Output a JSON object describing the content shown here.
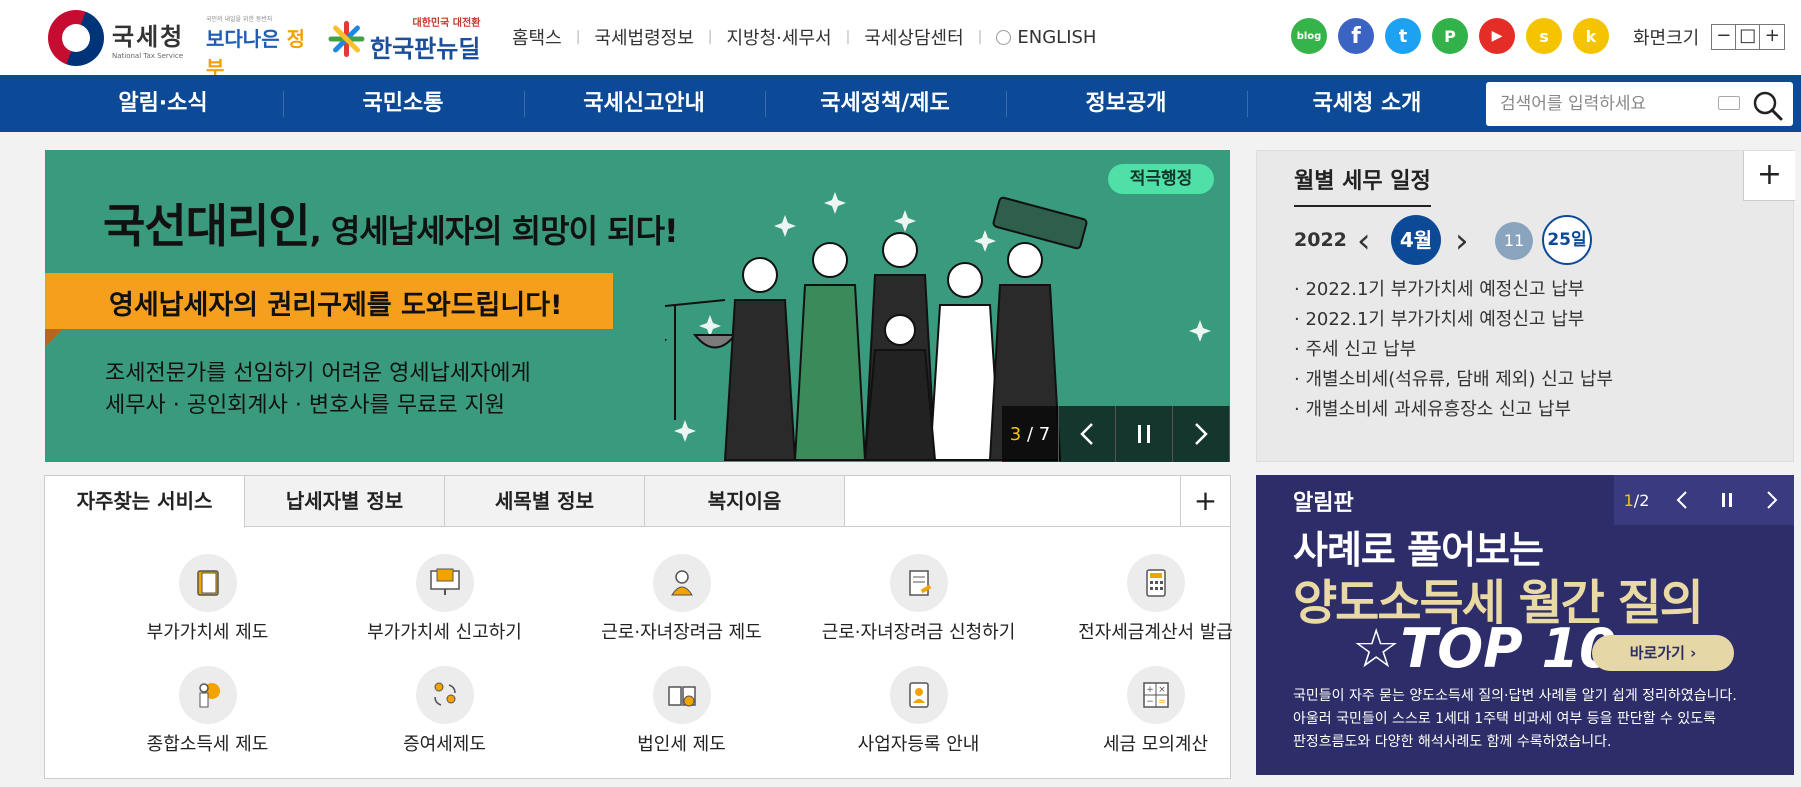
{
  "header": {
    "logo_kr": "국세청",
    "logo_en": "National Tax Service",
    "gov_logo_small": "국민의 내일을 위한 동반자",
    "gov_logo_text": "보다나은",
    "gov_logo_accent": "정부",
    "news_logo_small": "대한민국 대전환",
    "news_logo_text": "한국판뉴딜",
    "util_links": [
      "홈택스",
      "국세법령정보",
      "지방청·세무서",
      "국세상담센터",
      "ENGLISH"
    ],
    "sns": [
      {
        "name": "blog",
        "color": "#34b449",
        "glyph": "blog"
      },
      {
        "name": "facebook",
        "color": "#3b63c4",
        "glyph": "f"
      },
      {
        "name": "twitter",
        "color": "#1da1f2",
        "glyph": "t"
      },
      {
        "name": "naver-post",
        "color": "#33b24a",
        "glyph": "P"
      },
      {
        "name": "youtube",
        "color": "#e52d27",
        "glyph": "▶"
      },
      {
        "name": "kakao-story",
        "color": "#f5c400",
        "glyph": "s"
      },
      {
        "name": "kakao-channel",
        "color": "#f5c400",
        "glyph": "k"
      }
    ],
    "font_size_label": "화면크기",
    "font_size_buttons": [
      "−",
      "□",
      "+"
    ]
  },
  "gnb": {
    "items": [
      "알림·소식",
      "국민소통",
      "국세신고안내",
      "국세정책/제도",
      "정보공개",
      "국세청 소개"
    ],
    "search_placeholder": "검색어를 입력하세요"
  },
  "banner": {
    "tag": "적극행정",
    "headline_big": "국선대리인",
    "headline_small": ", 영세납세자의 희망이 되다!",
    "ribbon": "영세납세자의 권리구제를 도와드립니다!",
    "desc_line1": "조세전문가를 선임하기 어려운 영세납세자에게",
    "desc_line2": "세무사 · 공인회계사 · 변호사를 무료로 지원",
    "current": "3",
    "total": "7",
    "bg_color": "#3a9a7e"
  },
  "schedule": {
    "title": "월별 세무 일정",
    "year": "2022",
    "month": "4월",
    "day1": "11",
    "day2": "25일",
    "items": [
      "· 2022.1기 부가가치세 예정신고 납부",
      "· 2022.1기 부가가치세 예정신고 납부",
      "· 주세 신고 납부",
      "· 개별소비세(석유류, 담배 제외) 신고 납부",
      "· 개별소비세 과세유흥장소 신고 납부"
    ]
  },
  "services": {
    "tabs": [
      "자주찾는 서비스",
      "납세자별 정보",
      "세목별 정보",
      "복지이음"
    ],
    "items": [
      {
        "label": "부가가치세 제도",
        "icon": "book-icon"
      },
      {
        "label": "부가가치세 신고하기",
        "icon": "monitor-icon"
      },
      {
        "label": "근로·자녀장려금 제도",
        "icon": "person-icon"
      },
      {
        "label": "근로·자녀장려금 신청하기",
        "icon": "document-pen-icon"
      },
      {
        "label": "전자세금계산서 발급",
        "icon": "calculator-icon"
      },
      {
        "label": "종합소득세 제도",
        "icon": "person-bulb-icon"
      },
      {
        "label": "증여세제도",
        "icon": "people-exchange-icon"
      },
      {
        "label": "법인세 제도",
        "icon": "book-search-icon"
      },
      {
        "label": "사업자등록 안내",
        "icon": "id-card-icon"
      },
      {
        "label": "세금 모의계산",
        "icon": "calc-grid-icon"
      }
    ]
  },
  "notice": {
    "label": "알림판",
    "current": "1",
    "total": "2",
    "h1": "사례로 풀어보는",
    "h2": "양도소득세 월간 질의",
    "top10": "☆TOP 10",
    "go_label": "바로가기  ›",
    "text_line1": "국민들이 자주 묻는 양도소득세 질의·답변 사례를 알기 쉽게 정리하였습니다.",
    "text_line2": "아울러 국민들이 스스로 1세대 1주택 비과세 여부 등을 판단할 수 있도록",
    "text_line3": "판정흐름도와 다양한 해석사례도 함께 수록하였습니다."
  }
}
